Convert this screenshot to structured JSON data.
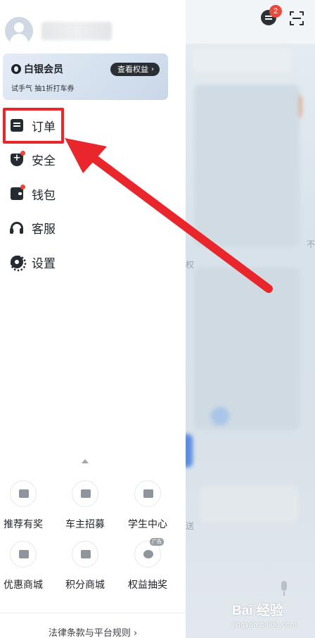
{
  "background": {
    "message_badge": "2",
    "side_text": "不",
    "left_text": "权",
    "left_text2": "送"
  },
  "drawer": {
    "member": {
      "title": "白银会员",
      "button": "查看权益",
      "subtitle": "试手气 抽1折打车券"
    },
    "menu": [
      {
        "label": "订单",
        "icon": "order-icon",
        "has_dot": false
      },
      {
        "label": "安全",
        "icon": "shield-icon",
        "has_dot": true
      },
      {
        "label": "钱包",
        "icon": "wallet-icon",
        "has_dot": true
      },
      {
        "label": "客服",
        "icon": "headset-icon",
        "has_dot": false
      },
      {
        "label": "设置",
        "icon": "gear-icon",
        "has_dot": false
      }
    ],
    "services": [
      {
        "label": "推荐有奖",
        "icon": "gift-icon"
      },
      {
        "label": "车主招募",
        "icon": "driver-icon"
      },
      {
        "label": "学生中心",
        "icon": "graduation-cap-icon"
      },
      {
        "label": "优惠商城",
        "icon": "coupon-icon"
      },
      {
        "label": "积分商城",
        "icon": "cart-icon"
      },
      {
        "label": "权益抽奖",
        "icon": "lottery-bag-icon",
        "tag": "广告"
      }
    ],
    "footer_link": "法律条款与平台规则"
  },
  "colors": {
    "highlight": "#e8262b",
    "dot": "#f04438"
  },
  "watermark": {
    "text": "Bai 经验",
    "url": "jingyan.baidu.com"
  }
}
